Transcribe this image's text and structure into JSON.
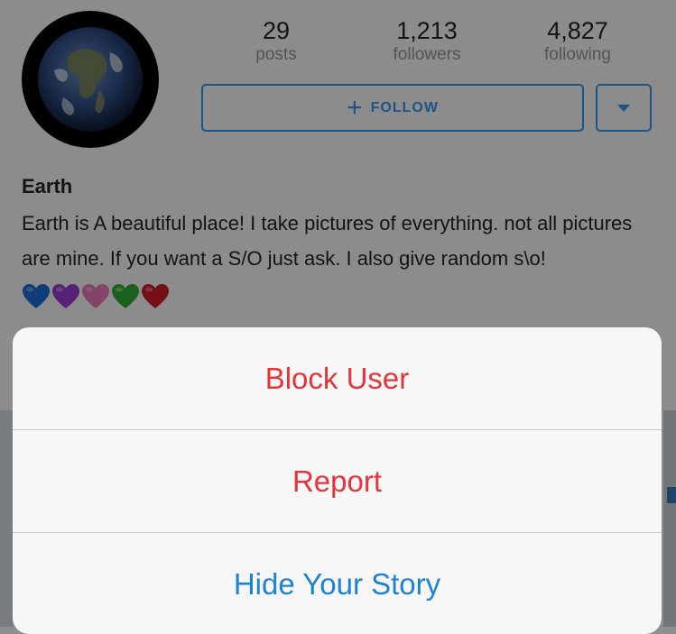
{
  "profile": {
    "name": "Earth",
    "bio": "Earth is A beautiful place! I take pictures of everything. not all pictures are mine. If you want a S/O just ask. I also give random s\\o!",
    "stats": [
      {
        "value": "29",
        "label": "posts"
      },
      {
        "value": "1,213",
        "label": "followers"
      },
      {
        "value": "4,827",
        "label": "following"
      }
    ],
    "follow_label": "FOLLOW",
    "heart_colors": [
      "#1e6fd9",
      "#9b3fd6",
      "#f07ac0",
      "#33b03a",
      "#d81e2a"
    ]
  },
  "action_sheet": {
    "items": [
      {
        "label": "Block User",
        "color": "#e5353b"
      },
      {
        "label": "Report",
        "color": "#e5353b"
      },
      {
        "label": "Hide Your Story",
        "color": "#1e82d7"
      }
    ]
  }
}
